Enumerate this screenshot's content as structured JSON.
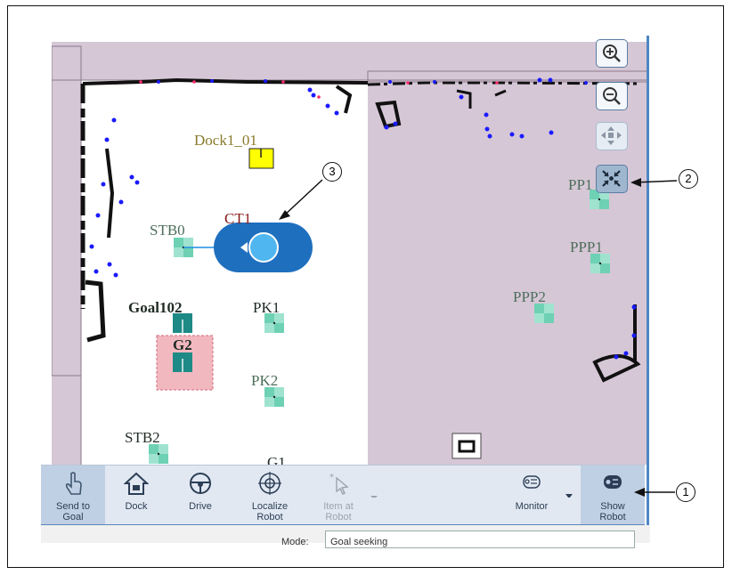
{
  "map": {
    "labels": {
      "dock": "Dock1_01",
      "ct": "CT1",
      "stb0": "STB0",
      "goal102": "Goal102",
      "pk1": "PK1",
      "g2": "G2",
      "pk2": "PK2",
      "stb2": "STB2",
      "g1": "G1",
      "pp1": "PP1",
      "ppp1": "PPP1",
      "ppp2": "PPP2"
    },
    "zoom_controls": [
      "zoom-in-icon",
      "zoom-out-icon",
      "pan-icon",
      "show-robot-center-icon"
    ]
  },
  "toolbar": {
    "send_to_goal": "Send to\nGoal",
    "dock": "Dock",
    "drive": "Drive",
    "localize": "Localize\nRobot",
    "item_at_robot": "Item at\nRobot",
    "monitor": "Monitor",
    "show_robot": "Show\nRobot"
  },
  "status": {
    "mode_label": "Mode:",
    "mode_value": "Goal seeking"
  },
  "callouts": {
    "c1": "1",
    "c2": "2",
    "c3": "3"
  },
  "colors": {
    "map_background": "#d6c7d6",
    "free_space": "#ffffff",
    "toolbar": "#e1e8f2",
    "robot": "#1f6fbf",
    "goal_marker": "#1e8a86",
    "dock_marker": "#ffff00",
    "forbidden_zone": "#f2b8c0",
    "accent": "#4f86c6"
  }
}
